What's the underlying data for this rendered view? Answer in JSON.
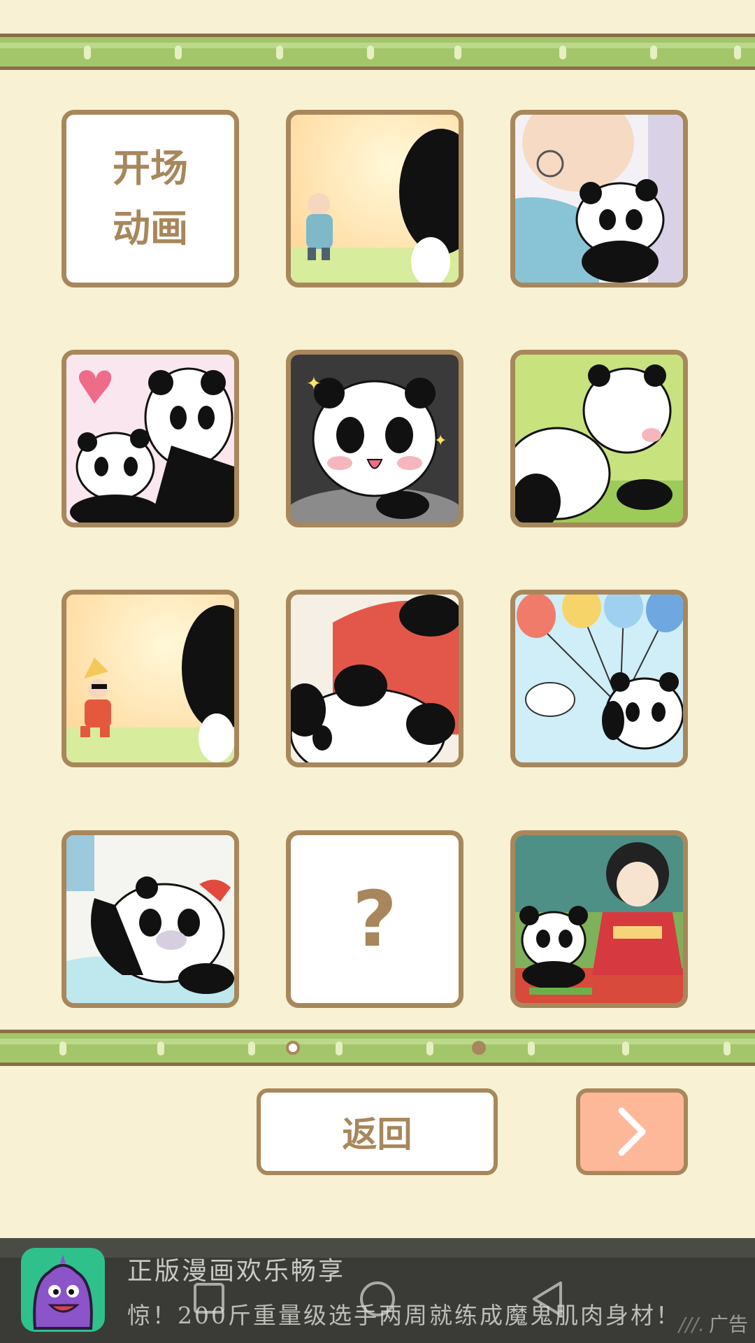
{
  "grid": {
    "tiles": [
      {
        "type": "text",
        "lines": [
          "开场",
          "动画"
        ]
      },
      {
        "type": "image",
        "scene": "grandpa-waving-at-panda"
      },
      {
        "type": "image",
        "scene": "grandpa-hugging-panda"
      },
      {
        "type": "image",
        "scene": "mother-panda-with-cub"
      },
      {
        "type": "image",
        "scene": "sparkling-panda-in-pot"
      },
      {
        "type": "image",
        "scene": "two-pandas-on-grass"
      },
      {
        "type": "image",
        "scene": "sunglasses-man-waving-at-panda"
      },
      {
        "type": "image",
        "scene": "man-in-red-holding-panda"
      },
      {
        "type": "image",
        "scene": "panda-with-balloons-and-bird"
      },
      {
        "type": "image",
        "scene": "panda-with-bow-splashing"
      },
      {
        "type": "text",
        "lines": [
          "?"
        ]
      },
      {
        "type": "image",
        "scene": "panda-with-kimono-girl"
      }
    ]
  },
  "pagination": {
    "count": 2,
    "active": 0
  },
  "buttons": {
    "back_label": "返回",
    "next_icon": "chevron-right-icon"
  },
  "ad": {
    "title": "正版漫画欢乐畅享",
    "description": "惊！200斤重量级选手两周就练成魔鬼肌肉身材！",
    "tag": "广告",
    "icon": "purple-ghost-app-icon"
  },
  "system_nav": [
    "square-recents-icon",
    "circle-home-icon",
    "triangle-back-icon"
  ],
  "colors": {
    "background": "#f8f1d4",
    "frame": "#a7875b",
    "bamboo": "#a3c66a",
    "next_button": "#fdb89a"
  }
}
